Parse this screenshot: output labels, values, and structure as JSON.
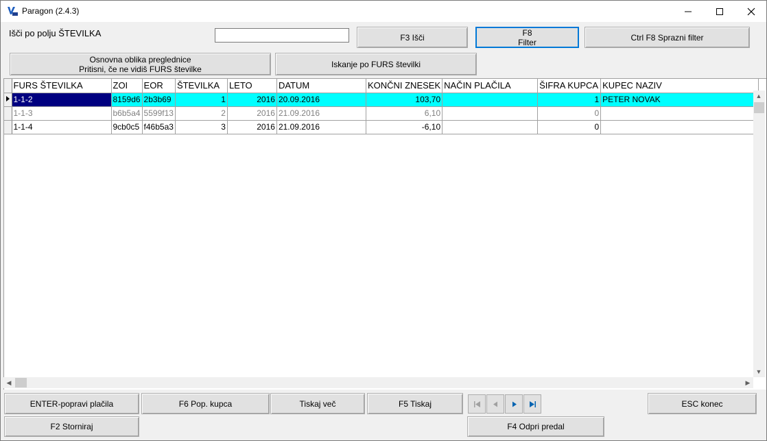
{
  "window": {
    "title": "Paragon  (2.4.3)"
  },
  "search": {
    "label": "Išči po polju ŠTEVILKA",
    "value": "",
    "placeholder": ""
  },
  "buttons": {
    "f3_search": "F3 Išči",
    "f8_filter": "F8 Filter",
    "ctrl_f8_clear": "Ctrl F8 Sprazni filter",
    "basic_view_line1": "Osnovna oblika preglednice",
    "basic_view_line2": "Pritisni, če ne vidiš FURS številke",
    "furs_search": "Iskanje po FURS številki",
    "enter_fix_payment": "ENTER-popravi plačila",
    "f6_customer": "F6 Pop. kupca",
    "print_more": "Tiskaj več",
    "f5_print": "F5 Tiskaj",
    "esc_end": "ESC  konec",
    "f2_cancel": "F2 Storniraj",
    "f4_open_drawer": "F4 Odpri predal"
  },
  "grid": {
    "columns": [
      "FURS ŠTEVILKA",
      "ZOI",
      "EOR",
      "ŠTEVILKA",
      "LETO",
      "DATUM",
      "KONČNI ZNESEK",
      "NAČIN PLAČILA",
      "ŠIFRA KUPCA",
      "KUPEC NAZIV"
    ],
    "rows": [
      {
        "furs": "1-1-2",
        "zoi": "8159d6",
        "eor": "2b3b69",
        "stevilka": "1",
        "leto": "2016",
        "datum": "20.09.2016",
        "znesek": "103,70",
        "nacin": "",
        "sifra": "1",
        "kupec": "PETER NOVAK"
      },
      {
        "furs": "1-1-3",
        "zoi": "b6b5a4",
        "eor": "5599f13",
        "stevilka": "2",
        "leto": "2016",
        "datum": "21.09.2016",
        "znesek": "6,10",
        "nacin": "",
        "sifra": "0",
        "kupec": ""
      },
      {
        "furs": "1-1-4",
        "zoi": "9cb0c5",
        "eor": "f46b5a3",
        "stevilka": "3",
        "leto": "2016",
        "datum": "21.09.2016",
        "znesek": "-6,10",
        "nacin": "",
        "sifra": "0",
        "kupec": ""
      }
    ]
  },
  "colors": {
    "selected_row": "#00ffff",
    "focused_cell": "#000080",
    "nav_blue": "#0063b1",
    "nav_disabled": "#a0a0a0"
  },
  "icons": {
    "first": "first-record-icon",
    "prev": "previous-record-icon",
    "next": "next-record-icon",
    "last": "last-record-icon"
  }
}
